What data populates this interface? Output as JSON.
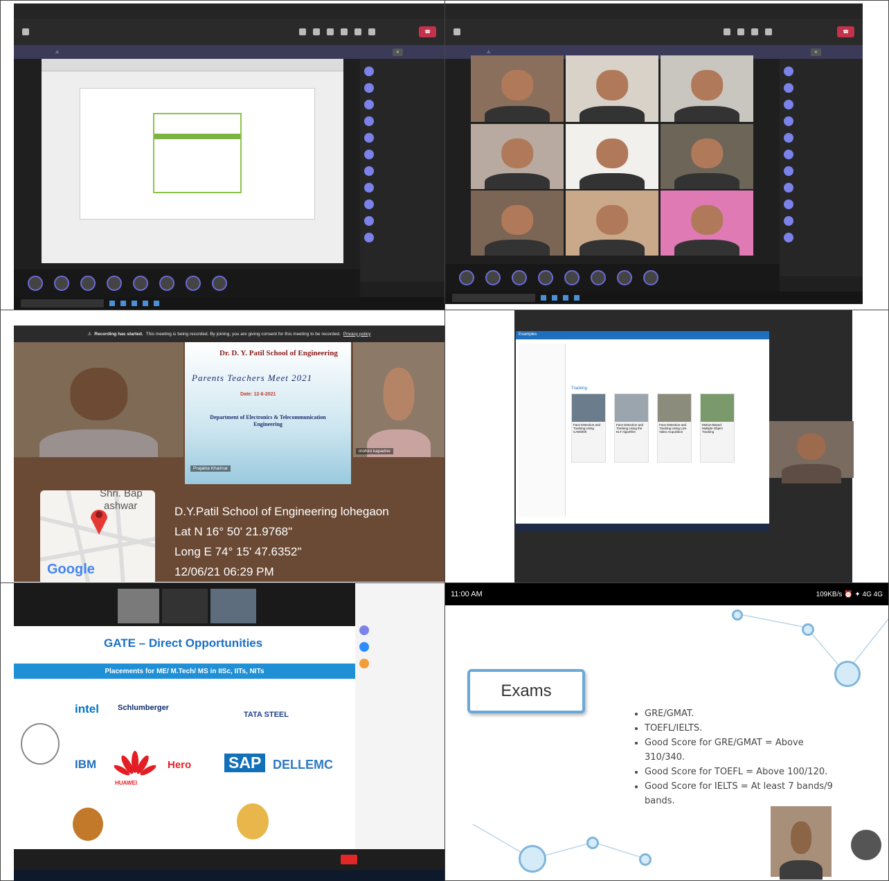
{
  "cells": {
    "recording_banner": "Recording has started.",
    "recording_msg": "This meeting is being recorded. By joining, you are giving consent for this meeting to be recorded.",
    "privacy_link": "Privacy policy",
    "poster": {
      "school": "Dr. D. Y. Patil School of Engineering",
      "title": "Parents Teachers Meet 2021",
      "date": "Date: 12-6-2021",
      "dept": "Department of Electronics & Telecommunication Engineering"
    },
    "names": {
      "prajakta": "Prajakta Khairnar",
      "mohini": "mohini kapadne"
    },
    "geotag": {
      "map_label_1": "Shri. Bap",
      "map_label_2": "ashwar",
      "map_brand": "Google",
      "place": "D.Y.Patil School of Engineering lohegaon",
      "lat": "Lat N 16° 50' 21.9768\"",
      "long": "Long E 74° 15' 47.6352\"",
      "datetime": "12/06/21 06:29 PM"
    },
    "gate": {
      "title": "GATE – Direct Opportunities",
      "placements": "Placements for ME/ M.Tech/ MS in IISc, IITs, NITs",
      "logos": [
        "intel",
        "Schlumberger",
        "TATA STEEL",
        "IBM",
        "HUAWEI",
        "Hero",
        "SAP",
        "DELLEMC"
      ]
    },
    "phone": {
      "time": "11:00 AM",
      "status": "109KB/s ⏰ ✦ 4G 4G",
      "box_label": "Exams",
      "bullets": [
        "GRE/GMAT.",
        "TOEFL/IELTS.",
        "Good Score for GRE/GMAT = Above 310/340.",
        "Good Score for TOEFL = Above 100/120.",
        "Good Score for IELTS = At least 7 bands/9 bands."
      ]
    },
    "c4": {
      "header": "Examples",
      "section": "Tracking",
      "tiles": [
        "Face Detection and Tracking Using CAMShift",
        "Face Detection and Tracking Using the KLT Algorithm",
        "Face Detection and Tracking Using Live Video Acquisition",
        "Motion-Based Multiple Object Tracking"
      ]
    }
  }
}
